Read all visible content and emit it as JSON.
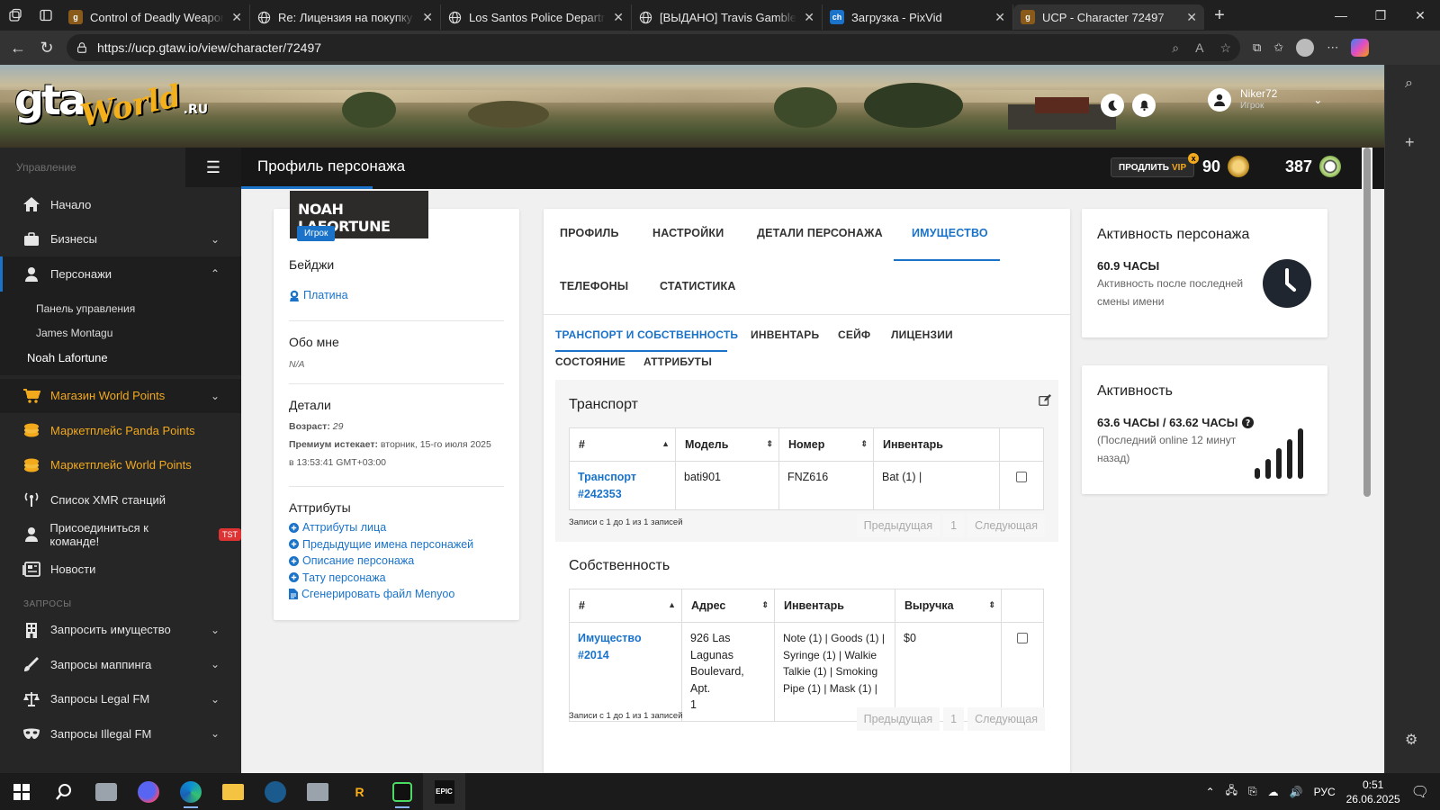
{
  "browser": {
    "tabs": [
      {
        "title": "Control of Deadly Weapons -",
        "favicon": "gta-world-favicon",
        "color": "#8a5a1a"
      },
      {
        "title": "Re: Лицензия на покупку ог",
        "favicon": "globe-icon",
        "color": ""
      },
      {
        "title": "Los Santos Police Departmen",
        "favicon": "globe-icon",
        "color": ""
      },
      {
        "title": "[ВЫДАНО] Travis Gamble [PF",
        "favicon": "globe-icon",
        "color": ""
      },
      {
        "title": "Загрузка - PixVid",
        "favicon": "pixvid-favicon",
        "color": "#1a73c9"
      },
      {
        "title": "UCP - Character 72497",
        "favicon": "gta-world-favicon",
        "color": "#8a5a1a"
      }
    ],
    "url": "https://ucp.gtaw.io/view/character/72497"
  },
  "header": {
    "user_name": "Niker72",
    "user_role": "Игрок"
  },
  "sidebar": {
    "section_main": "Управление",
    "items": [
      {
        "label": "Начало",
        "icon": "home-icon"
      },
      {
        "label": "Бизнесы",
        "icon": "briefcase-icon"
      },
      {
        "label": "Персонажи",
        "icon": "user-icon"
      }
    ],
    "sub_items": [
      "Панель управления",
      "James Montagu",
      "Noah Lafortune"
    ],
    "shop_label": "Магазин World Points",
    "market_panda": "Маркетплейс Panda Points",
    "market_world": "Маркетплейс World Points",
    "xmr": "Список XMR станций",
    "join": "Присоединиться к команде!",
    "join_badge": "TST",
    "news": "Новости",
    "section_requests": "ЗАПРОСЫ",
    "requests": [
      "Запросить имущество",
      "Запросы маппинга",
      "Запросы Legal FM",
      "Запросы Illegal FM"
    ]
  },
  "topbar": {
    "title": "Профиль персонажа",
    "vip_label_1": "ПРОДЛИТЬ",
    "vip_label_2": "VIP",
    "vip_badge": "x",
    "world_points": "90",
    "panda_points": "387"
  },
  "character": {
    "name": "NOAH LAFORTUNE",
    "role_badge": "Игрок",
    "badges_title": "Бейджи",
    "badge": "Платина",
    "about_title": "Обо мне",
    "about_value": "N/A",
    "details_title": "Детали",
    "age_label": "Возраст:",
    "age_value": "29",
    "premium_label": "Премиум истекает:",
    "premium_value": "вторник, 15-го июля 2025",
    "premium_time": "в 13:53:41 GMT+03:00",
    "attributes_title": "Аттрибуты",
    "attribute_links": [
      "Аттрибуты лица",
      "Предыдущие имена персонажей",
      "Описание персонажа",
      "Тату персонажа",
      "Сгенерировать файл Menyoo"
    ]
  },
  "main_tabs": [
    "ПРОФИЛЬ",
    "НАСТРОЙКИ",
    "ДЕТАЛИ ПЕРСОНАЖА",
    "ИМУЩЕСТВО",
    "ТЕЛЕФОНЫ",
    "СТАТИСТИКА"
  ],
  "sub_tabs": [
    "ТРАНСПОРТ И СОБСТВЕННОСТЬ",
    "ИНВЕНТАРЬ",
    "СЕЙФ",
    "ЛИЦЕНЗИИ",
    "СОСТОЯНИЕ",
    "АТТРИБУТЫ"
  ],
  "vehicles": {
    "title": "Транспорт",
    "columns": [
      "#",
      "Модель",
      "Номер",
      "Инвентарь"
    ],
    "rows": [
      {
        "id_line1": "Транспорт",
        "id_line2": "#242353",
        "model": "bati901",
        "plate": "FNZ616",
        "inventory": "Bat (1) |"
      }
    ],
    "info": "Записи с 1 до 1 из 1 записей",
    "prev": "Предыдущая",
    "page": "1",
    "next": "Следующая"
  },
  "properties": {
    "title": "Собственность",
    "columns": [
      "#",
      "Адрес",
      "Инвентарь",
      "Выручка"
    ],
    "rows": [
      {
        "id_line1": "Имущество",
        "id_line2": "#2014",
        "address": [
          "926 Las",
          "Lagunas",
          "Boulevard, Apt.",
          "1"
        ],
        "inventory": [
          "Note (1) | Goods (1) |",
          "Syringe (1) | Walkie",
          "Talkie (1) | Smoking",
          "Pipe (1) | Mask (1) |"
        ],
        "revenue": "$0"
      }
    ],
    "info": "Записи с 1 до 1 из 1 записей",
    "prev": "Предыдущая",
    "page": "1",
    "next": "Следующая"
  },
  "activity_character": {
    "title": "Активность персонажа",
    "hours": "60.9 ЧАСЫ",
    "desc_1": "Активность после последней",
    "desc_2": "смены имени"
  },
  "activity": {
    "title": "Активность",
    "hours": "63.6 ЧАСЫ / 63.62 ЧАСЫ",
    "desc_1": "(Последний online 12 минут",
    "desc_2": "назад)"
  },
  "taskbar": {
    "lang": "РУС",
    "time": "0:51",
    "date": "26.06.2025"
  },
  "colors": {
    "accent": "#1a73c9",
    "gold": "#f2a91c",
    "sidebar": "#262626"
  }
}
